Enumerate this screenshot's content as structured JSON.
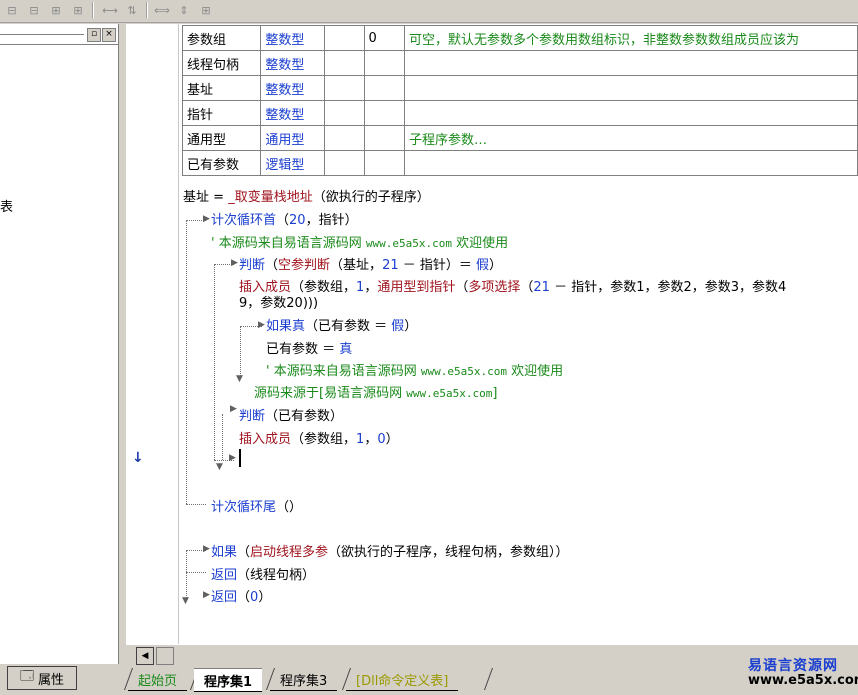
{
  "toolbar": {
    "buttons": [
      {
        "icon": "align-left-icon",
        "glyph": "⊟"
      },
      {
        "icon": "align-center-icon",
        "glyph": "⊟"
      },
      {
        "icon": "align-top-icon",
        "glyph": "⊞"
      },
      {
        "icon": "align-middle-icon",
        "glyph": "⊞"
      },
      {
        "icon": "space-horizontal-icon",
        "glyph": "⟷"
      },
      {
        "icon": "space-vertical-icon",
        "glyph": "⇅"
      },
      {
        "icon": "width-equal-icon",
        "glyph": "⟺"
      },
      {
        "icon": "height-equal-icon",
        "glyph": "⇕"
      },
      {
        "icon": "size-equal-icon",
        "glyph": "⊞"
      }
    ]
  },
  "left_panel": {
    "pin_glyph": "▫",
    "close_glyph": "×",
    "clipped_text": "表"
  },
  "params_table": {
    "rows": [
      {
        "name": "参数组",
        "type": "整数型",
        "ref": "",
        "array": "0",
        "note": "可空，默认无参数多个参数用数组标识，非整数参数数组成员应该为"
      },
      {
        "name": "线程句柄",
        "type": "整数型",
        "ref": "",
        "array": "",
        "note": ""
      },
      {
        "name": "基址",
        "type": "整数型",
        "ref": "",
        "array": "",
        "note": ""
      },
      {
        "name": "指针",
        "type": "整数型",
        "ref": "",
        "array": "",
        "note": ""
      },
      {
        "name": "通用型",
        "type": "通用型",
        "ref": "",
        "array": "",
        "note": "子程序参数…"
      },
      {
        "name": "已有参数",
        "type": "逻辑型",
        "ref": "",
        "array": "",
        "note": ""
      }
    ]
  },
  "code": {
    "l1a": "基址",
    "l1b": " = ",
    "l1c": "_取变量栈地址",
    "l1d": "（欲执行的子程序）",
    "l2a": "计次循环首",
    "l2b": "（",
    "l2c": "20",
    "l2d": "，指针）",
    "l3a": "' 本源码来自易语言源码网 ",
    "l3b": "www.e5a5x.com",
    "l3c": "  欢迎使用",
    "l4a": "判断",
    "l4b": "（",
    "l4c": "空参判断",
    "l4d": "（基址，",
    "l4e": "21",
    "l4f": " － 指针）＝ ",
    "l4g": "假",
    "l4h": "）",
    "l5a": "插入成员",
    "l5b": "（参数组，",
    "l5c": "1",
    "l5d": "，",
    "l5e": "通用型到指针",
    "l5f": "（",
    "l5g": "多项选择",
    "l5h": "（",
    "l5i": "21",
    "l5j": " － 指针，参数1，参数2，参数3，参数4",
    "l6": "9，参数20)))",
    "l7a": "如果真",
    "l7b": "（已有参数 ＝ ",
    "l7c": "假",
    "l7d": "）",
    "l8a": "已有参数",
    "l8b": " ＝ ",
    "l8c": "真",
    "l9a": "' 本源码来自易语言源码网 ",
    "l9b": "www.e5a5x.com",
    "l9c": "  欢迎使用",
    "l10a": "源码来源于[易语言源码网 ",
    "l10b": "www.e5a5x.com",
    "l10c": "]",
    "l11a": "判断",
    "l11b": "（已有参数）",
    "l12a": "插入成员",
    "l12b": "（参数组，",
    "l12c": "1",
    "l12d": "，",
    "l12e": "0",
    "l12f": "）",
    "l13a": "计次循环尾",
    "l13b": "（）",
    "l14a": "如果",
    "l14b": "（",
    "l14c": "启动线程多参",
    "l14d": "（欲执行的子程序，线程句柄，参数组））",
    "l15a": "返回",
    "l15b": "（线程句柄）",
    "l16a": "返回",
    "l16b": "（",
    "l16c": "0",
    "l16d": "）"
  },
  "gutter_arrow": "↓",
  "bottom": {
    "properties_tab": "属性",
    "tabs": [
      "起始页",
      "程序集1",
      "程序集3",
      "[Dll命令定义表]"
    ],
    "active_tab": "程序集1"
  },
  "watermark": {
    "cn": "易语言资源网",
    "url": "www.e5a5x.com"
  }
}
